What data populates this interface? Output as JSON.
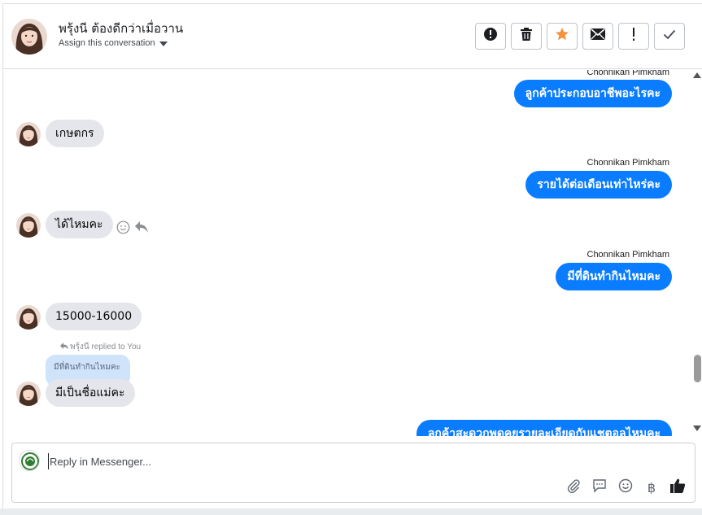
{
  "header": {
    "contact_name": "พรุ้งนี ต้องดีกว่าเมื่อวาน",
    "assign_label": "Assign this conversation",
    "actions": [
      {
        "name": "spam-button",
        "icon": "alert-circle-icon"
      },
      {
        "name": "delete-button",
        "icon": "trash-icon"
      },
      {
        "name": "star-button",
        "icon": "star-icon"
      },
      {
        "name": "mark-unread-button",
        "icon": "envelope-icon"
      },
      {
        "name": "mark-important-button",
        "icon": "exclamation-icon"
      },
      {
        "name": "mark-done-button",
        "icon": "checkmark-icon"
      }
    ]
  },
  "messages": {
    "m1_sender": "Chonnikan Pimkham",
    "m1_text": "ลูกค้าประกอบอาชีพอะไรคะ",
    "m2_text": "เกษตกร",
    "m3_sender": "Chonnikan Pimkham",
    "m3_text": "รายได้ต่อเดือนเท่าไหร่คะ",
    "m4_text": "ได้ไหมคะ",
    "m5_sender": "Chonnikan Pimkham",
    "m5_text": "มีที่ดินทำกินไหมคะ",
    "m6_text": "15000-16000",
    "m7_reply_note": "พรุ้งนี replied to You",
    "m7_quoted": "มีที่ดินทำกินไหมคะ",
    "m7_text": "มีเป็นชื่อแม่คะ",
    "m8_text": "ลูกค้าสะดวกพูดคุยรายละเอียดกับแชตอลไหมคะ"
  },
  "composer": {
    "placeholder": "Reply in Messenger...",
    "tools": [
      "paperclip-icon",
      "saved-reply-icon",
      "emoji-icon",
      "baht-icon",
      "thumbs-up-icon"
    ],
    "baht_symbol": "฿"
  },
  "colors": {
    "outgoing_bubble": "#0a7cff",
    "incoming_bubble": "#e4e6eb",
    "quoted_bubble": "#cfe3fb",
    "star": "#f5913e"
  }
}
